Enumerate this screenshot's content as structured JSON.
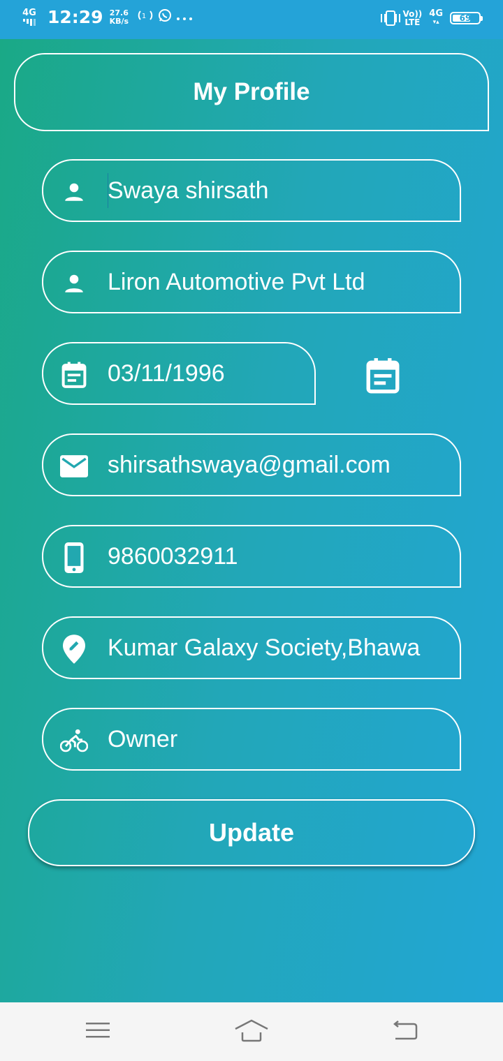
{
  "status_bar": {
    "network": "4G",
    "time": "12:29",
    "speed_value": "27.6",
    "speed_unit": "KB/s",
    "volte_top": "Vo))",
    "volte_bottom": "LTE",
    "network_right": "4G",
    "battery": "69",
    "battery_level_percent": 69,
    "icons": [
      "signal-icon",
      "hotspot-icon",
      "whatsapp-icon",
      "more-dots-icon",
      "vibrate-icon",
      "battery-icon"
    ]
  },
  "header": {
    "title": "My Profile"
  },
  "form": {
    "name": {
      "value": "Swaya shirsath",
      "icon": "person-icon"
    },
    "company": {
      "value": "Liron Automotive Pvt Ltd",
      "icon": "person-icon"
    },
    "dob": {
      "value": "03/11/1996",
      "icon": "calendar-icon"
    },
    "email": {
      "value": "shirsathswaya@gmail.com",
      "icon": "mail-icon"
    },
    "phone": {
      "value": "9860032911",
      "icon": "phone-icon"
    },
    "address": {
      "value": "Kumar Galaxy Society,Bhawa",
      "icon": "location-edit-icon"
    },
    "role": {
      "value": "Owner",
      "icon": "bicycle-icon"
    }
  },
  "actions": {
    "update_label": "Update"
  },
  "nav": {
    "buttons": [
      "menu-icon",
      "home-icon",
      "back-icon"
    ]
  },
  "colors": {
    "gradient_start": "#1aa985",
    "gradient_end": "#22a6d6",
    "status_bar": "#24a3d8",
    "nav_bar": "#f5f5f5"
  }
}
